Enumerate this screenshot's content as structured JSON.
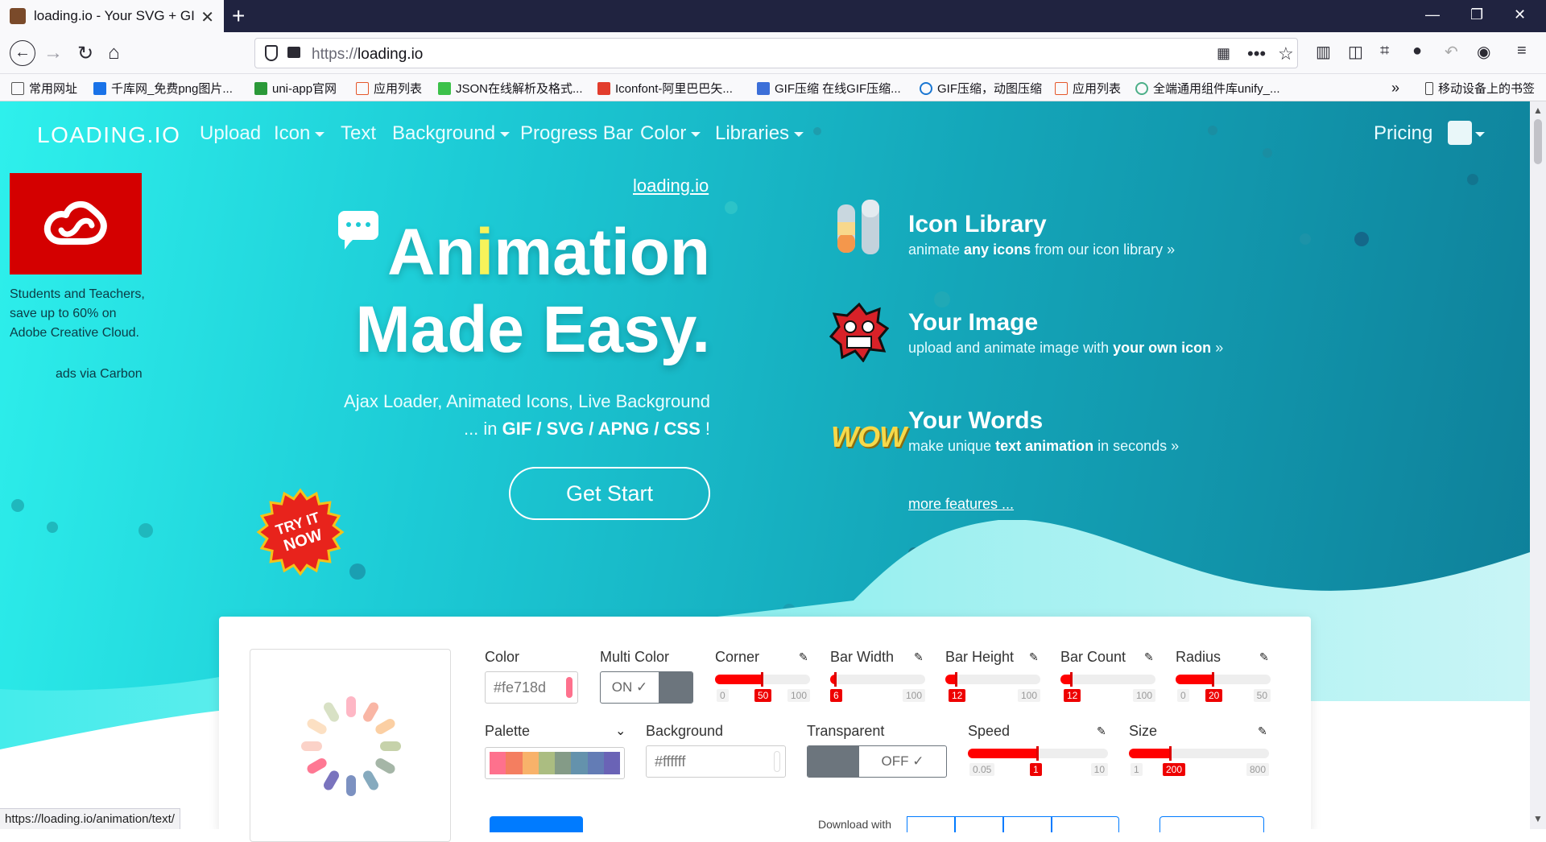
{
  "browser": {
    "tab_title": "loading.io - Your SVG + GIF",
    "url_proto": "https://",
    "url_host": "loading.io",
    "bookmarks": [
      "常用网址",
      "千库网_免费png图片...",
      "uni-app官网",
      "应用列表",
      "JSON在线解析及格式...",
      "Iconfont-阿里巴巴矢...",
      "GIF压缩 在线GIF压缩...",
      "GIF压缩，动图压缩",
      "应用列表",
      "全端通用组件库unify_...",
      "移动设备上的书签"
    ],
    "status_url": "https://loading.io/animation/text/"
  },
  "nav": {
    "brand": "LOADING.IO",
    "links": [
      "Upload",
      "Icon",
      "Text",
      "Background",
      "Progress Bar",
      "Color",
      "Libraries"
    ],
    "pricing": "Pricing"
  },
  "ad": {
    "text": "Students and Teachers, save up to 60% on Adobe Creative Cloud.",
    "via": "ads via Carbon"
  },
  "hero": {
    "link": "loading.io",
    "title_part1": "An",
    "title_i": "i",
    "title_part2": "mation",
    "title_line2": "Made Easy.",
    "sub_line1": "Ajax Loader, Animated Icons, Live Background",
    "sub_prefix": "... in ",
    "sub_formats": "GIF / SVG / APNG / CSS",
    "sub_suffix": " !",
    "cta": "Get Start"
  },
  "features": [
    {
      "title": "Icon Library",
      "desc_pre": "animate ",
      "desc_bold": "any icons",
      "desc_post": " from our icon library"
    },
    {
      "title": "Your Image",
      "desc_pre": "upload and animate image with ",
      "desc_bold": "your own icon",
      "desc_post": ""
    },
    {
      "title": "Your Words",
      "desc_pre": "make unique ",
      "desc_bold": "text animation",
      "desc_post": " in seconds"
    }
  ],
  "wow_text": "WOW",
  "more_features": "more features ...",
  "badge": {
    "line1": "TRY IT",
    "line2": "NOW"
  },
  "controls": {
    "color": {
      "label": "Color",
      "value": "#fe718d"
    },
    "multi_color": {
      "label": "Multi Color",
      "value": "ON"
    },
    "corner": {
      "label": "Corner",
      "min": "0",
      "cur": "50",
      "max": "100",
      "fraction": 0.5
    },
    "bar_width": {
      "label": "Bar Width",
      "min": "1",
      "cur": "6",
      "max": "100",
      "fraction": 0.06
    },
    "bar_height": {
      "label": "Bar Height",
      "min": "1",
      "cur": "12",
      "max": "100",
      "fraction": 0.12
    },
    "bar_count": {
      "label": "Bar Count",
      "min": "4",
      "cur": "12",
      "max": "100",
      "fraction": 0.12
    },
    "radius": {
      "label": "Radius",
      "min": "0",
      "cur": "20",
      "max": "50",
      "fraction": 0.4
    },
    "palette": {
      "label": "Palette",
      "colors": [
        "#fe718d",
        "#f47e60",
        "#f8b26a",
        "#abbd81",
        "#849b87",
        "#6492ac",
        "#637cb5",
        "#6a63b6"
      ]
    },
    "background": {
      "label": "Background",
      "value": "#ffffff"
    },
    "transparent": {
      "label": "Transparent",
      "value": "OFF"
    },
    "speed": {
      "label": "Speed",
      "min": "0.05",
      "cur": "1",
      "max": "10",
      "fraction": 0.5
    },
    "size": {
      "label": "Size",
      "min": "1",
      "cur": "200",
      "max": "800",
      "fraction": 0.3
    }
  },
  "download_label": "Download with",
  "colors": {
    "accent": "#1ccad5",
    "slider_red": "#ff0000",
    "primary_blue": "#007bff"
  }
}
